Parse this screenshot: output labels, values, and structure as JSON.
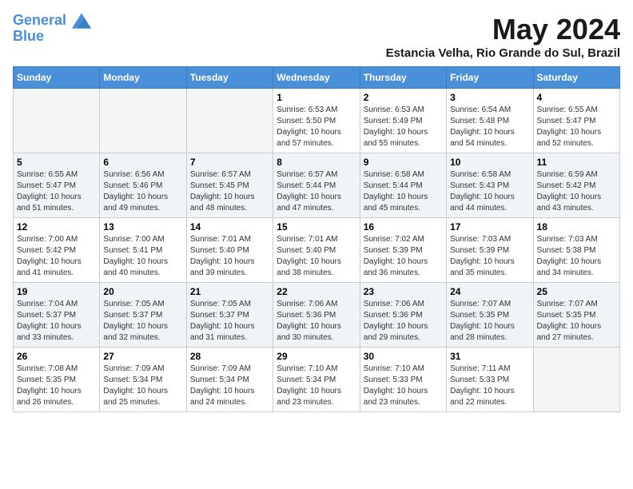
{
  "header": {
    "logo_line1": "General",
    "logo_line2": "Blue",
    "month_title": "May 2024",
    "location": "Estancia Velha, Rio Grande do Sul, Brazil"
  },
  "days_of_week": [
    "Sunday",
    "Monday",
    "Tuesday",
    "Wednesday",
    "Thursday",
    "Friday",
    "Saturday"
  ],
  "weeks": [
    {
      "shaded": false,
      "days": [
        {
          "date": "",
          "info": ""
        },
        {
          "date": "",
          "info": ""
        },
        {
          "date": "",
          "info": ""
        },
        {
          "date": "1",
          "info": "Sunrise: 6:53 AM\nSunset: 5:50 PM\nDaylight: 10 hours\nand 57 minutes."
        },
        {
          "date": "2",
          "info": "Sunrise: 6:53 AM\nSunset: 5:49 PM\nDaylight: 10 hours\nand 55 minutes."
        },
        {
          "date": "3",
          "info": "Sunrise: 6:54 AM\nSunset: 5:48 PM\nDaylight: 10 hours\nand 54 minutes."
        },
        {
          "date": "4",
          "info": "Sunrise: 6:55 AM\nSunset: 5:47 PM\nDaylight: 10 hours\nand 52 minutes."
        }
      ]
    },
    {
      "shaded": true,
      "days": [
        {
          "date": "5",
          "info": "Sunrise: 6:55 AM\nSunset: 5:47 PM\nDaylight: 10 hours\nand 51 minutes."
        },
        {
          "date": "6",
          "info": "Sunrise: 6:56 AM\nSunset: 5:46 PM\nDaylight: 10 hours\nand 49 minutes."
        },
        {
          "date": "7",
          "info": "Sunrise: 6:57 AM\nSunset: 5:45 PM\nDaylight: 10 hours\nand 48 minutes."
        },
        {
          "date": "8",
          "info": "Sunrise: 6:57 AM\nSunset: 5:44 PM\nDaylight: 10 hours\nand 47 minutes."
        },
        {
          "date": "9",
          "info": "Sunrise: 6:58 AM\nSunset: 5:44 PM\nDaylight: 10 hours\nand 45 minutes."
        },
        {
          "date": "10",
          "info": "Sunrise: 6:58 AM\nSunset: 5:43 PM\nDaylight: 10 hours\nand 44 minutes."
        },
        {
          "date": "11",
          "info": "Sunrise: 6:59 AM\nSunset: 5:42 PM\nDaylight: 10 hours\nand 43 minutes."
        }
      ]
    },
    {
      "shaded": false,
      "days": [
        {
          "date": "12",
          "info": "Sunrise: 7:00 AM\nSunset: 5:42 PM\nDaylight: 10 hours\nand 41 minutes."
        },
        {
          "date": "13",
          "info": "Sunrise: 7:00 AM\nSunset: 5:41 PM\nDaylight: 10 hours\nand 40 minutes."
        },
        {
          "date": "14",
          "info": "Sunrise: 7:01 AM\nSunset: 5:40 PM\nDaylight: 10 hours\nand 39 minutes."
        },
        {
          "date": "15",
          "info": "Sunrise: 7:01 AM\nSunset: 5:40 PM\nDaylight: 10 hours\nand 38 minutes."
        },
        {
          "date": "16",
          "info": "Sunrise: 7:02 AM\nSunset: 5:39 PM\nDaylight: 10 hours\nand 36 minutes."
        },
        {
          "date": "17",
          "info": "Sunrise: 7:03 AM\nSunset: 5:39 PM\nDaylight: 10 hours\nand 35 minutes."
        },
        {
          "date": "18",
          "info": "Sunrise: 7:03 AM\nSunset: 5:38 PM\nDaylight: 10 hours\nand 34 minutes."
        }
      ]
    },
    {
      "shaded": true,
      "days": [
        {
          "date": "19",
          "info": "Sunrise: 7:04 AM\nSunset: 5:37 PM\nDaylight: 10 hours\nand 33 minutes."
        },
        {
          "date": "20",
          "info": "Sunrise: 7:05 AM\nSunset: 5:37 PM\nDaylight: 10 hours\nand 32 minutes."
        },
        {
          "date": "21",
          "info": "Sunrise: 7:05 AM\nSunset: 5:37 PM\nDaylight: 10 hours\nand 31 minutes."
        },
        {
          "date": "22",
          "info": "Sunrise: 7:06 AM\nSunset: 5:36 PM\nDaylight: 10 hours\nand 30 minutes."
        },
        {
          "date": "23",
          "info": "Sunrise: 7:06 AM\nSunset: 5:36 PM\nDaylight: 10 hours\nand 29 minutes."
        },
        {
          "date": "24",
          "info": "Sunrise: 7:07 AM\nSunset: 5:35 PM\nDaylight: 10 hours\nand 28 minutes."
        },
        {
          "date": "25",
          "info": "Sunrise: 7:07 AM\nSunset: 5:35 PM\nDaylight: 10 hours\nand 27 minutes."
        }
      ]
    },
    {
      "shaded": false,
      "days": [
        {
          "date": "26",
          "info": "Sunrise: 7:08 AM\nSunset: 5:35 PM\nDaylight: 10 hours\nand 26 minutes."
        },
        {
          "date": "27",
          "info": "Sunrise: 7:09 AM\nSunset: 5:34 PM\nDaylight: 10 hours\nand 25 minutes."
        },
        {
          "date": "28",
          "info": "Sunrise: 7:09 AM\nSunset: 5:34 PM\nDaylight: 10 hours\nand 24 minutes."
        },
        {
          "date": "29",
          "info": "Sunrise: 7:10 AM\nSunset: 5:34 PM\nDaylight: 10 hours\nand 23 minutes."
        },
        {
          "date": "30",
          "info": "Sunrise: 7:10 AM\nSunset: 5:33 PM\nDaylight: 10 hours\nand 23 minutes."
        },
        {
          "date": "31",
          "info": "Sunrise: 7:11 AM\nSunset: 5:33 PM\nDaylight: 10 hours\nand 22 minutes."
        },
        {
          "date": "",
          "info": ""
        }
      ]
    }
  ]
}
